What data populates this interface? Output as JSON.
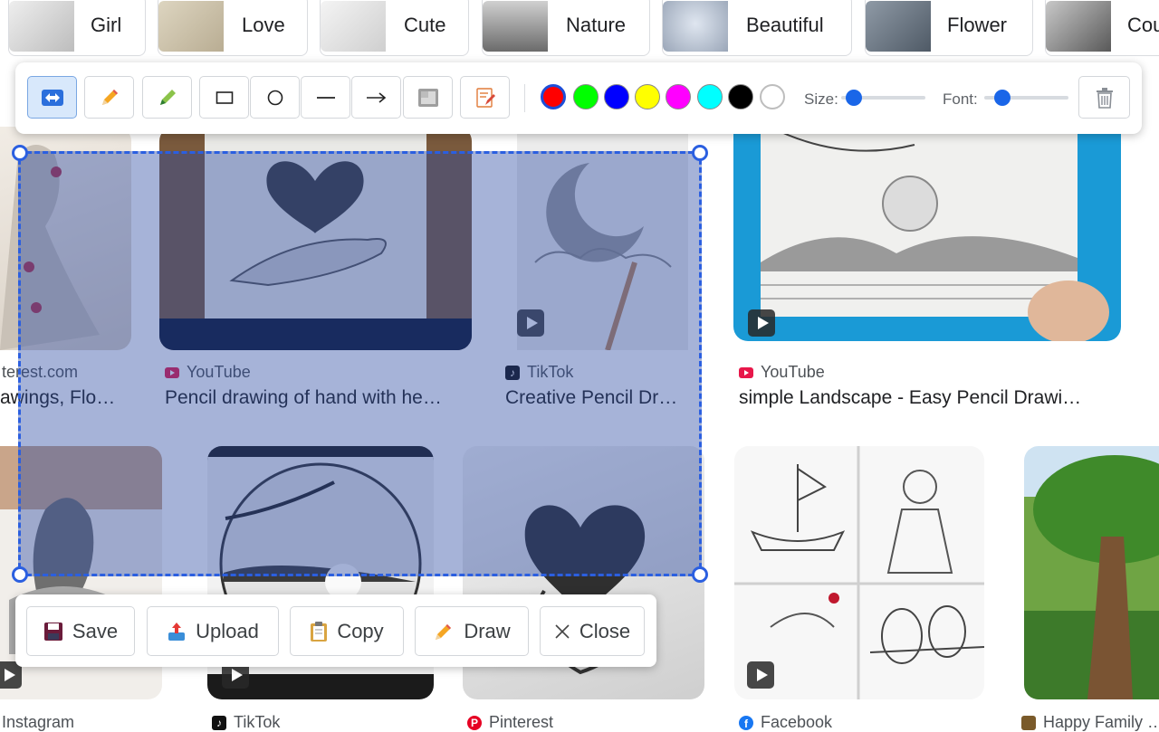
{
  "chips": [
    {
      "label": "Girl"
    },
    {
      "label": "Love"
    },
    {
      "label": "Cute"
    },
    {
      "label": "Nature"
    },
    {
      "label": "Beautiful"
    },
    {
      "label": "Flower"
    },
    {
      "label": "Cou"
    }
  ],
  "results": [
    {
      "source": "terest.com",
      "title": "awings, Flo…"
    },
    {
      "source": "YouTube",
      "title": "Pencil drawing of hand with he…"
    },
    {
      "source": "TikTok",
      "title": "Creative Pencil Dr…"
    },
    {
      "source": "YouTube",
      "title": "simple Landscape - Easy Pencil Drawi…"
    },
    {
      "source": "Instagram",
      "title": ""
    },
    {
      "source": "TikTok",
      "title": ""
    },
    {
      "source": "Pinterest",
      "title": ""
    },
    {
      "source": "Facebook",
      "title": ""
    },
    {
      "source": "Happy Family …",
      "title": ""
    }
  ],
  "toolbar": {
    "tools": [
      "select-move",
      "pencil",
      "highlighter",
      "rectangle",
      "circle",
      "line",
      "arrow",
      "blur",
      "text"
    ],
    "colors": [
      "#ff0000",
      "#00ff00",
      "#0000ff",
      "#ffff00",
      "#ff00ff",
      "#00ffff",
      "#000000",
      "#ffffff"
    ],
    "selected_color": "#ff0000",
    "size_label": "Size:",
    "font_label": "Font:",
    "size_value": 0.15,
    "font_value": 0.22
  },
  "actions": {
    "save": "Save",
    "upload": "Upload",
    "copy": "Copy",
    "draw": "Draw",
    "close": "Close"
  }
}
